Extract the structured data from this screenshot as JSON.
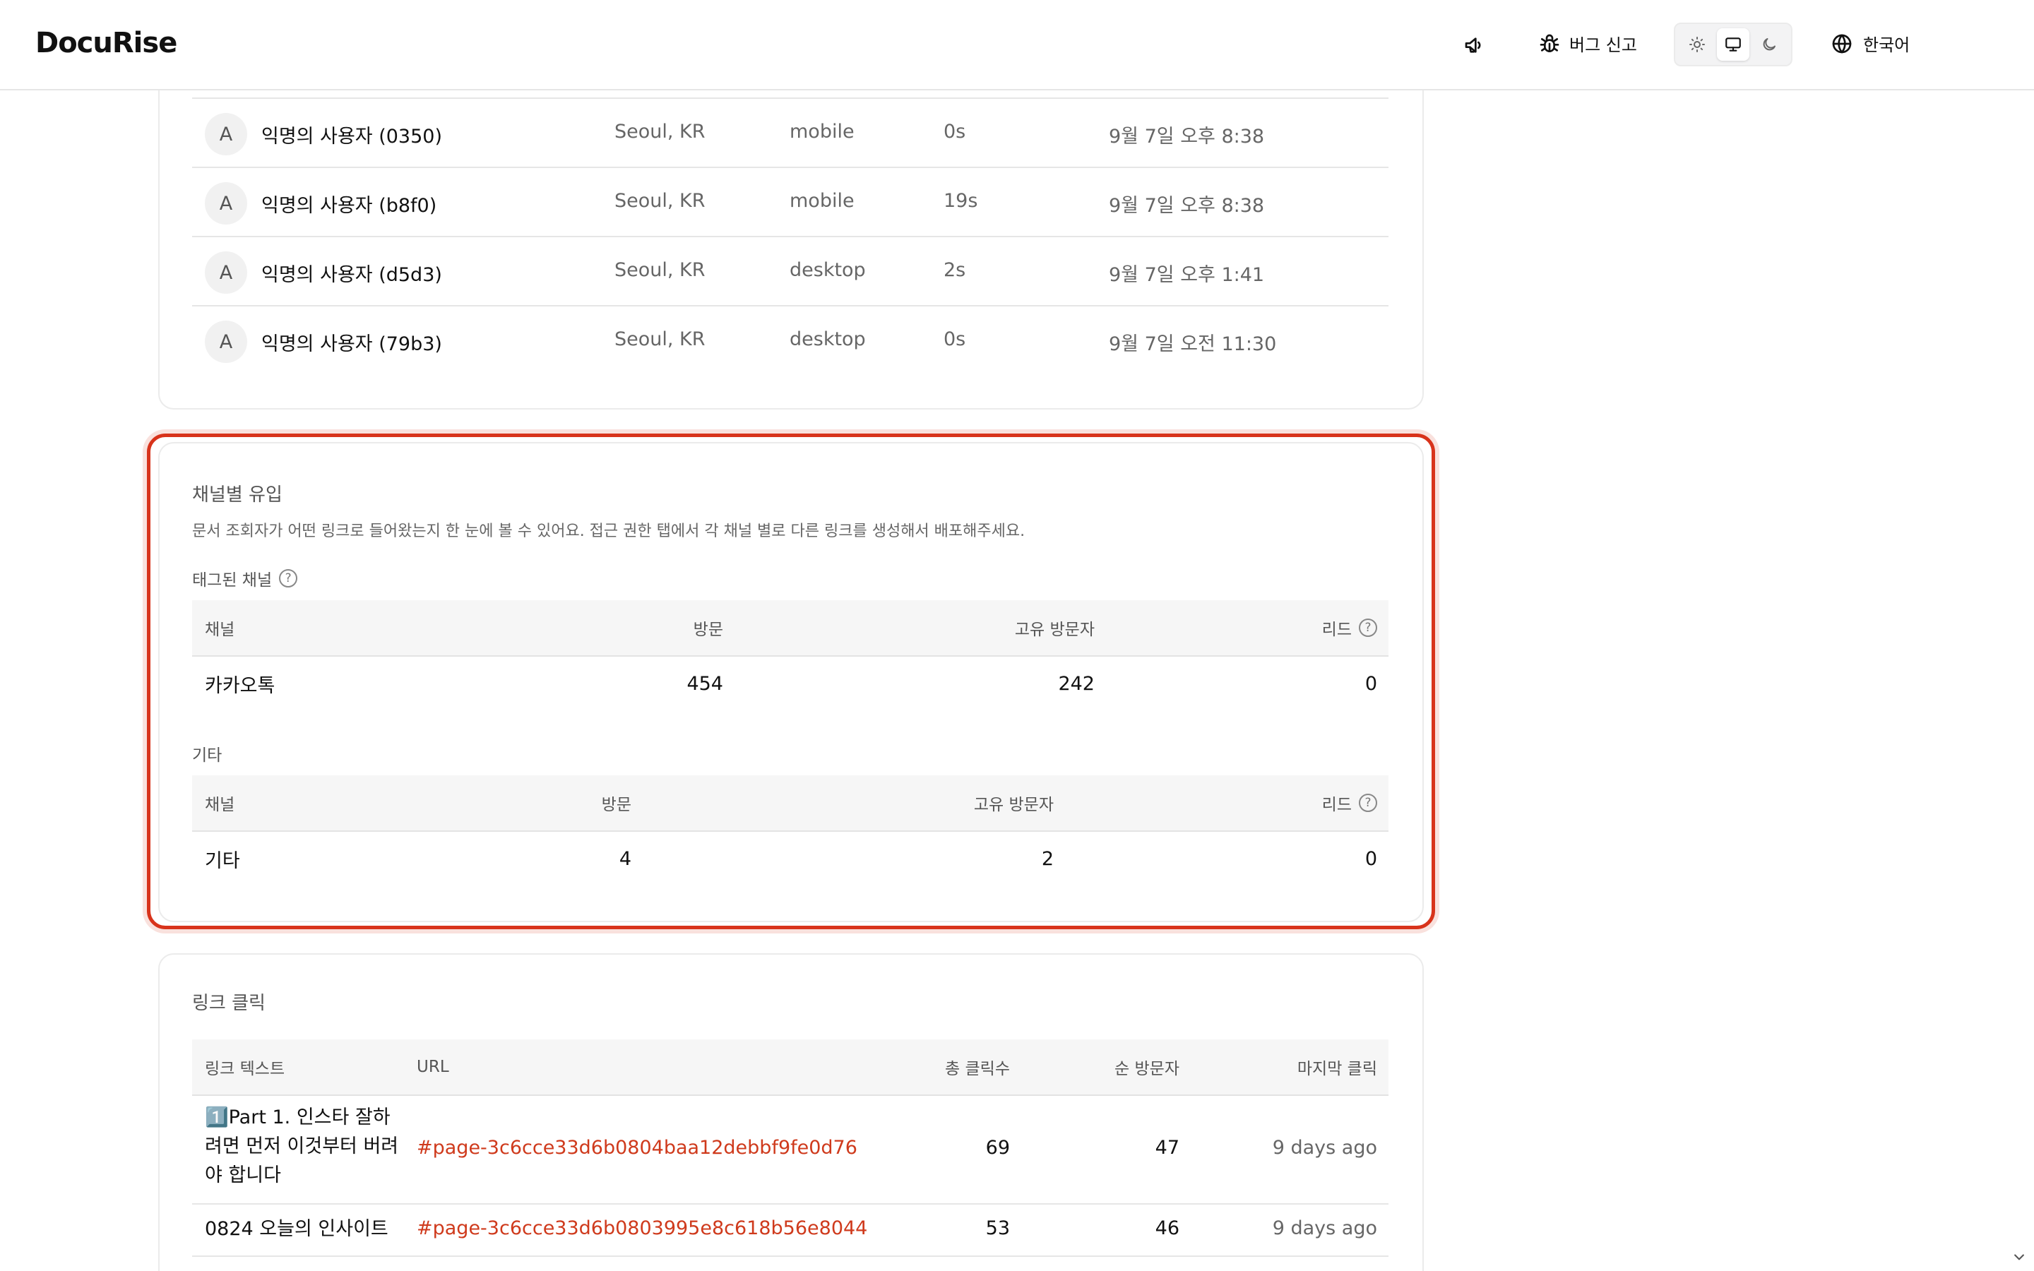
{
  "header": {
    "logo": "DocuRise",
    "bug_report_label": "버그 신고",
    "language_label": "한국어"
  },
  "visitors": {
    "rows": [
      {
        "avatar": "A",
        "name": "익명의 사용자 (0350)",
        "location": "Seoul, KR",
        "device": "mobile",
        "duration": "0s",
        "time": "9월 7일 오후 8:38"
      },
      {
        "avatar": "A",
        "name": "익명의 사용자 (b8f0)",
        "location": "Seoul, KR",
        "device": "mobile",
        "duration": "19s",
        "time": "9월 7일 오후 8:38"
      },
      {
        "avatar": "A",
        "name": "익명의 사용자 (d5d3)",
        "location": "Seoul, KR",
        "device": "desktop",
        "duration": "2s",
        "time": "9월 7일 오후 1:41"
      },
      {
        "avatar": "A",
        "name": "익명의 사용자 (79b3)",
        "location": "Seoul, KR",
        "device": "desktop",
        "duration": "0s",
        "time": "9월 7일 오전 11:30"
      }
    ]
  },
  "channels": {
    "title": "채널별 유입",
    "description": "문서 조회자가 어떤 링크로 들어왔는지 한 눈에 볼 수 있어요. 접근 권한 탭에서 각 채널 별로 다른 링크를 생성해서 배포해주세요.",
    "tagged": {
      "label": "태그된 채널",
      "columns": [
        "채널",
        "방문",
        "고유 방문자",
        "리드"
      ],
      "rows": [
        {
          "channel": "카카오톡",
          "visits": "454",
          "unique": "242",
          "leads": "0"
        }
      ]
    },
    "other": {
      "label": "기타",
      "columns": [
        "채널",
        "방문",
        "고유 방문자",
        "리드"
      ],
      "rows": [
        {
          "channel": "기타",
          "visits": "4",
          "unique": "2",
          "leads": "0"
        }
      ]
    }
  },
  "link_clicks": {
    "title": "링크 클릭",
    "columns": [
      "링크 텍스트",
      "URL",
      "총 클릭수",
      "순 방문자",
      "마지막 클릭"
    ],
    "rows": [
      {
        "text": "1️⃣Part 1. 인스타 잘하려면 먼저 이것부터 버려야 합니다",
        "text_lines": [
          "1️⃣Part 1. 인스타 잘하",
          "려면 먼저 이것부터 버려",
          "야 합니다"
        ],
        "url": "#page-3c6cce33d6b0804baa12debbf9fe0d76",
        "clicks": "69",
        "unique": "47",
        "last": "9 days ago"
      },
      {
        "text": "0824 오늘의 인사이트",
        "text_lines": [
          "0824 오늘의 인사이트"
        ],
        "url": "#page-3c6cce33d6b0803995e8c618b56e8044",
        "clicks": "53",
        "unique": "46",
        "last": "9 days ago"
      }
    ]
  },
  "colors": {
    "accent_red": "#d8331b",
    "link_red": "#cf3a1c"
  }
}
